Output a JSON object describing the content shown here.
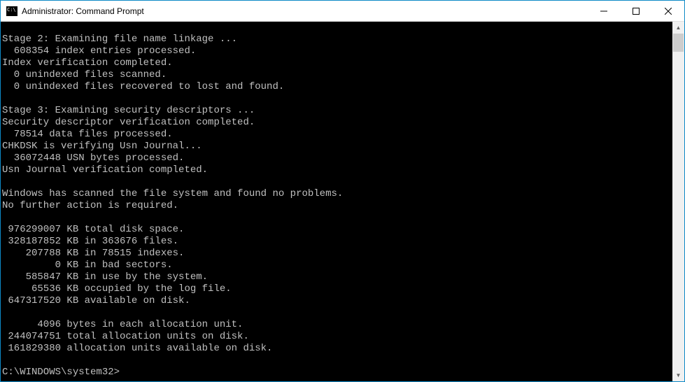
{
  "window": {
    "title": "Administrator: Command Prompt"
  },
  "lines": {
    "l0": "",
    "l1": "Stage 2: Examining file name linkage ...",
    "l2": "  608354 index entries processed.",
    "l3": "Index verification completed.",
    "l4": "  0 unindexed files scanned.",
    "l5": "  0 unindexed files recovered to lost and found.",
    "l6": "",
    "l7": "Stage 3: Examining security descriptors ...",
    "l8": "Security descriptor verification completed.",
    "l9": "  78514 data files processed.",
    "l10": "CHKDSK is verifying Usn Journal...",
    "l11": "  36072448 USN bytes processed.",
    "l12": "Usn Journal verification completed.",
    "l13": "",
    "l14": "Windows has scanned the file system and found no problems.",
    "l15": "No further action is required.",
    "l16": "",
    "l17": " 976299007 KB total disk space.",
    "l18": " 328187852 KB in 363676 files.",
    "l19": "    207788 KB in 78515 indexes.",
    "l20": "         0 KB in bad sectors.",
    "l21": "    585847 KB in use by the system.",
    "l22": "     65536 KB occupied by the log file.",
    "l23": " 647317520 KB available on disk.",
    "l24": "",
    "l25": "      4096 bytes in each allocation unit.",
    "l26": " 244074751 total allocation units on disk.",
    "l27": " 161829380 allocation units available on disk.",
    "l28": "",
    "l29": "C:\\WINDOWS\\system32>"
  }
}
